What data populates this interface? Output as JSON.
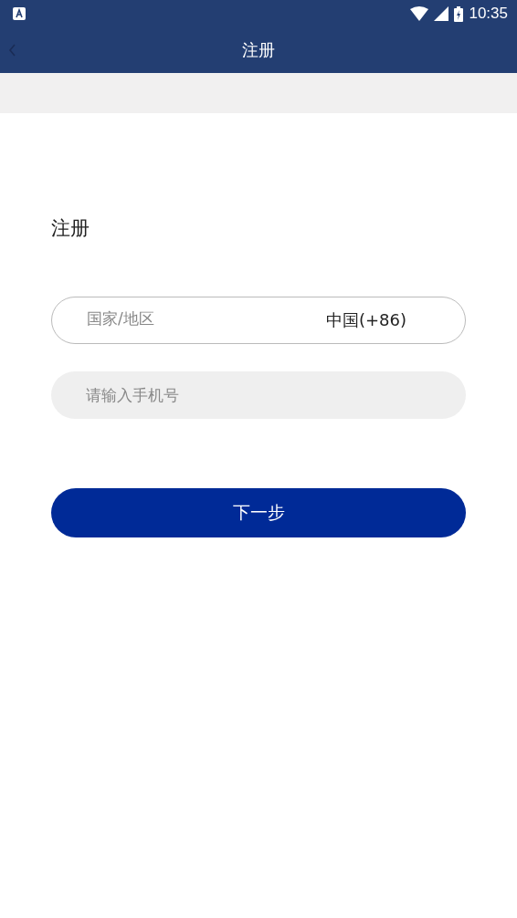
{
  "status_bar": {
    "time": "10:35"
  },
  "header": {
    "title": "注册"
  },
  "heading": "注册",
  "country": {
    "label": "国家/地区",
    "value": "中国(+86)"
  },
  "phone": {
    "placeholder": "请输入手机号"
  },
  "next_button": "下一步"
}
